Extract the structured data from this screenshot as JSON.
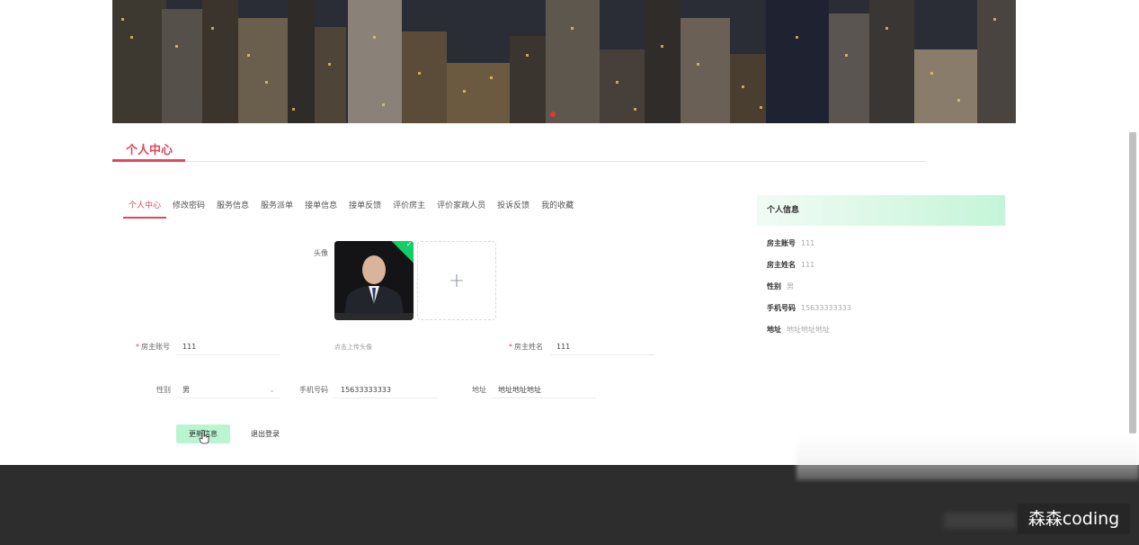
{
  "section": {
    "title": "个人中心"
  },
  "tabs": [
    {
      "label": "个人中心",
      "active": true
    },
    {
      "label": "修改密码"
    },
    {
      "label": "服务信息"
    },
    {
      "label": "服务派单"
    },
    {
      "label": "接单信息"
    },
    {
      "label": "接单反馈"
    },
    {
      "label": "评价房主"
    },
    {
      "label": "评价家政人员"
    },
    {
      "label": "投诉反馈"
    },
    {
      "label": "我的收藏"
    }
  ],
  "form": {
    "avatar_label": "头像",
    "upload_plus": "+",
    "upload_hint": "点击上传头像",
    "owner_account": {
      "label": "房主账号",
      "value": "111"
    },
    "owner_name": {
      "label": "房主姓名",
      "value": "111"
    },
    "gender": {
      "label": "性别",
      "value": "男"
    },
    "phone": {
      "label": "手机号码",
      "value": "15633333333"
    },
    "address": {
      "label": "地址",
      "value": "地址地址地址"
    },
    "required_mark": "*",
    "check_mark": "✓",
    "select_arrow": "⌄"
  },
  "buttons": {
    "update": "更新信息",
    "logout": "退出登录"
  },
  "panel": {
    "title": "个人信息",
    "rows": [
      {
        "label": "房主账号",
        "value": "111"
      },
      {
        "label": "房主姓名",
        "value": "111"
      },
      {
        "label": "性别",
        "value": "男"
      },
      {
        "label": "手机号码",
        "value": "15633333333"
      },
      {
        "label": "地址",
        "value": "地址地址地址"
      }
    ]
  },
  "watermark": "森森coding",
  "colors": {
    "accent": "#e0475a",
    "update_button": "#b8f5d0",
    "panel_head": "#c4f5d8",
    "footer": "#2d2d2d"
  }
}
